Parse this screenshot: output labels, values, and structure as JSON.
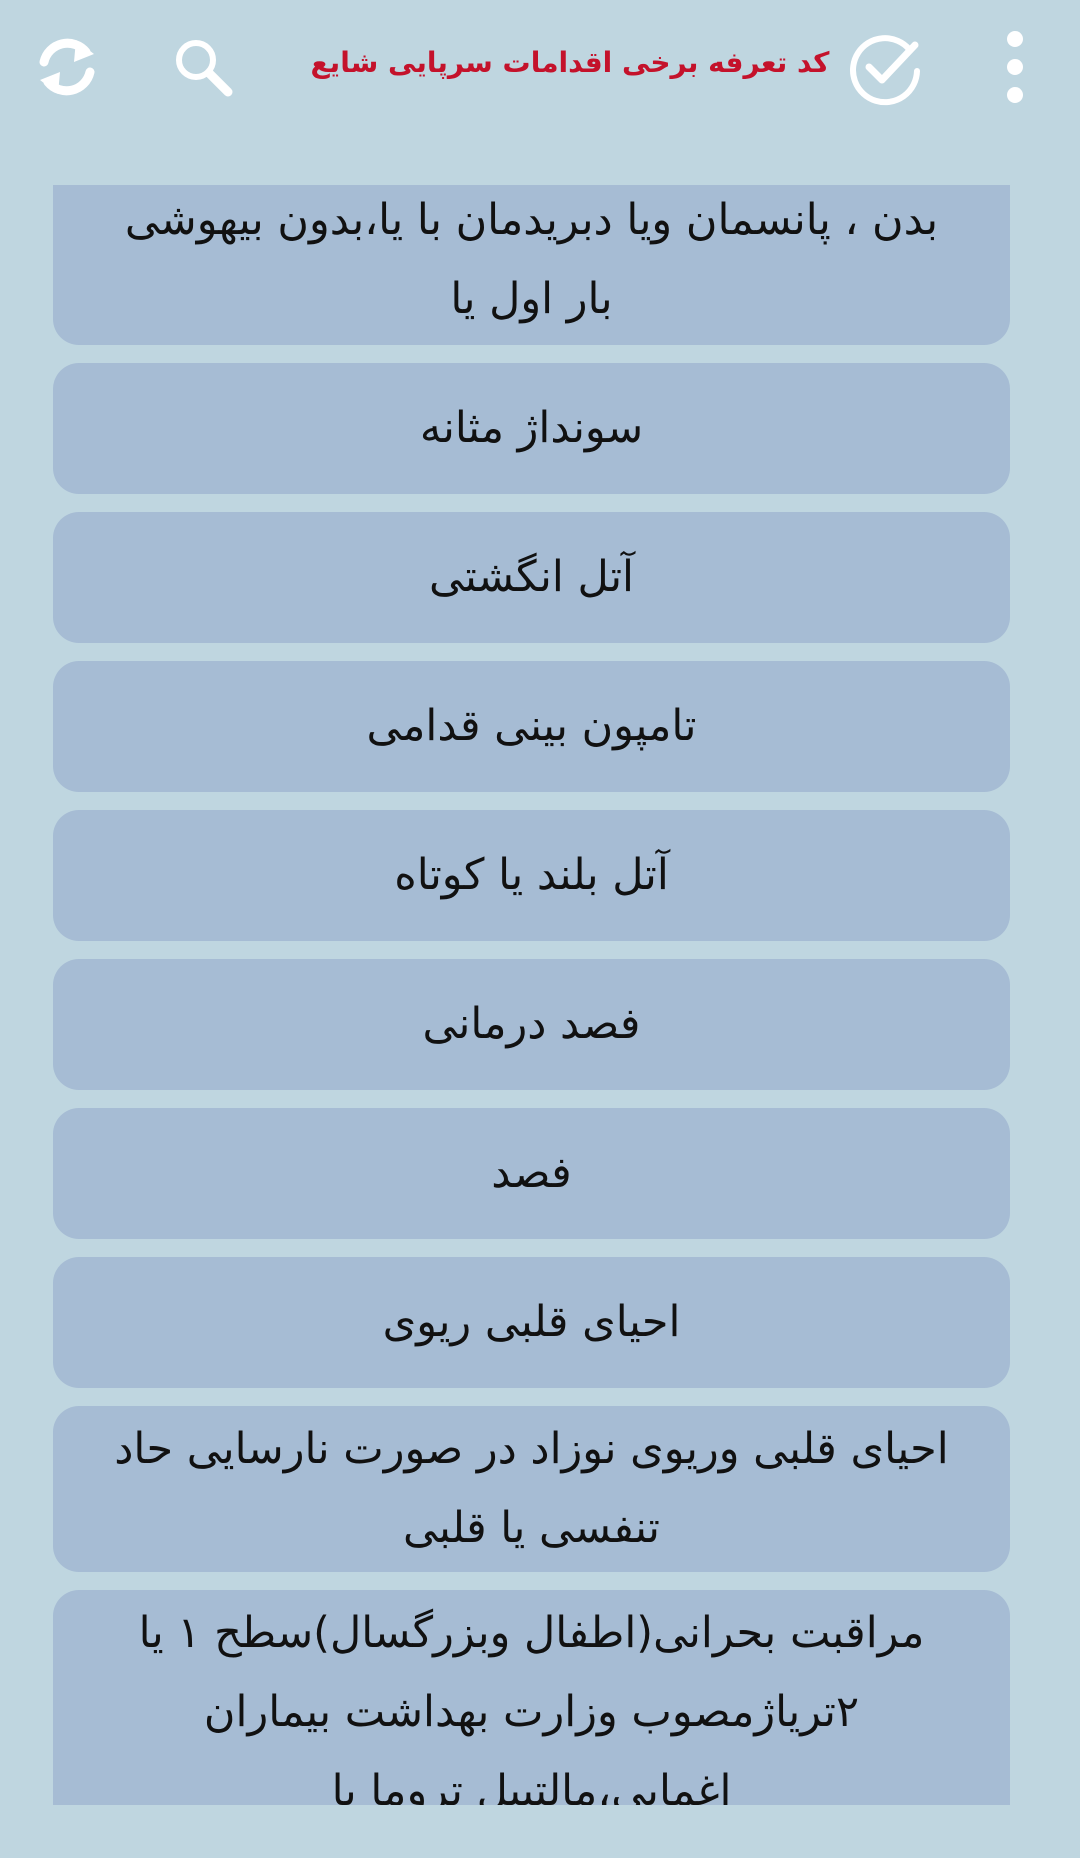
{
  "header": {
    "title": "کد تعرفه برخی اقدامات سرپایی شایع",
    "icons": [
      "refresh-icon",
      "search-icon",
      "check-circle-icon",
      "more-vert-icon"
    ]
  },
  "list": {
    "items": [
      {
        "label": "بدن ، پانسمان ویا دبریدمان با یا،بدون بیهوشی بار اول یا"
      },
      {
        "label": "سونداژ مثانه"
      },
      {
        "label": "آتل انگشتی"
      },
      {
        "label": "تامپون بینی قدامی"
      },
      {
        "label": "آتل بلند یا کوتاه"
      },
      {
        "label": "فصد درمانی"
      },
      {
        "label": "فصد"
      },
      {
        "label": "احیای قلبی ریوی"
      },
      {
        "label": "احیای قلبی وریوی نوزاد در صورت نارسایی حاد تنفسی یا قلبی"
      },
      {
        "label": "مراقبت بحرانی(اطفال وبزرگسال)سطح ۱ یا ۲تریاژمصوب وزارت بهداشت بیماران اغمایی،مالتیپل تروما یا"
      }
    ]
  },
  "colors": {
    "background": "#bfd6e0",
    "item_background": "#a6bcd4",
    "title": "#c4122b"
  }
}
